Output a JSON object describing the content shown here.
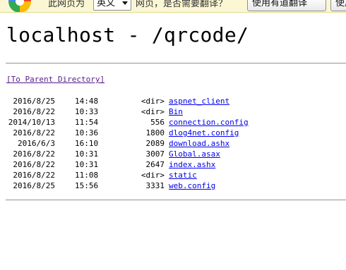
{
  "translate_bar": {
    "prompt_before": "此网页为",
    "language": "英文",
    "prompt_after": "网页，是否需要翻译？",
    "translate_button": "使用有道翻译",
    "options_button": "使用"
  },
  "page": {
    "title": "localhost - /qrcode/",
    "parent_link": "[To Parent Directory]"
  },
  "listing": [
    {
      "date": "2016/8/25",
      "time": "14:48",
      "size": "<dir>",
      "name": "aspnet_client"
    },
    {
      "date": "2016/8/22",
      "time": "10:33",
      "size": "<dir>",
      "name": "Bin"
    },
    {
      "date": "2014/10/13",
      "time": "11:54",
      "size": "556",
      "name": "connection.config"
    },
    {
      "date": "2016/8/22",
      "time": "10:36",
      "size": "1800",
      "name": "dlog4net.config"
    },
    {
      "date": "2016/6/3",
      "time": "16:10",
      "size": "2089",
      "name": "download.ashx"
    },
    {
      "date": "2016/8/22",
      "time": "10:31",
      "size": "3007",
      "name": "Global.asax"
    },
    {
      "date": "2016/8/22",
      "time": "10:31",
      "size": "2647",
      "name": "index.ashx"
    },
    {
      "date": "2016/8/22",
      "time": "11:08",
      "size": "<dir>",
      "name": "static"
    },
    {
      "date": "2016/8/25",
      "time": "15:56",
      "size": "3331",
      "name": "web.config"
    }
  ]
}
